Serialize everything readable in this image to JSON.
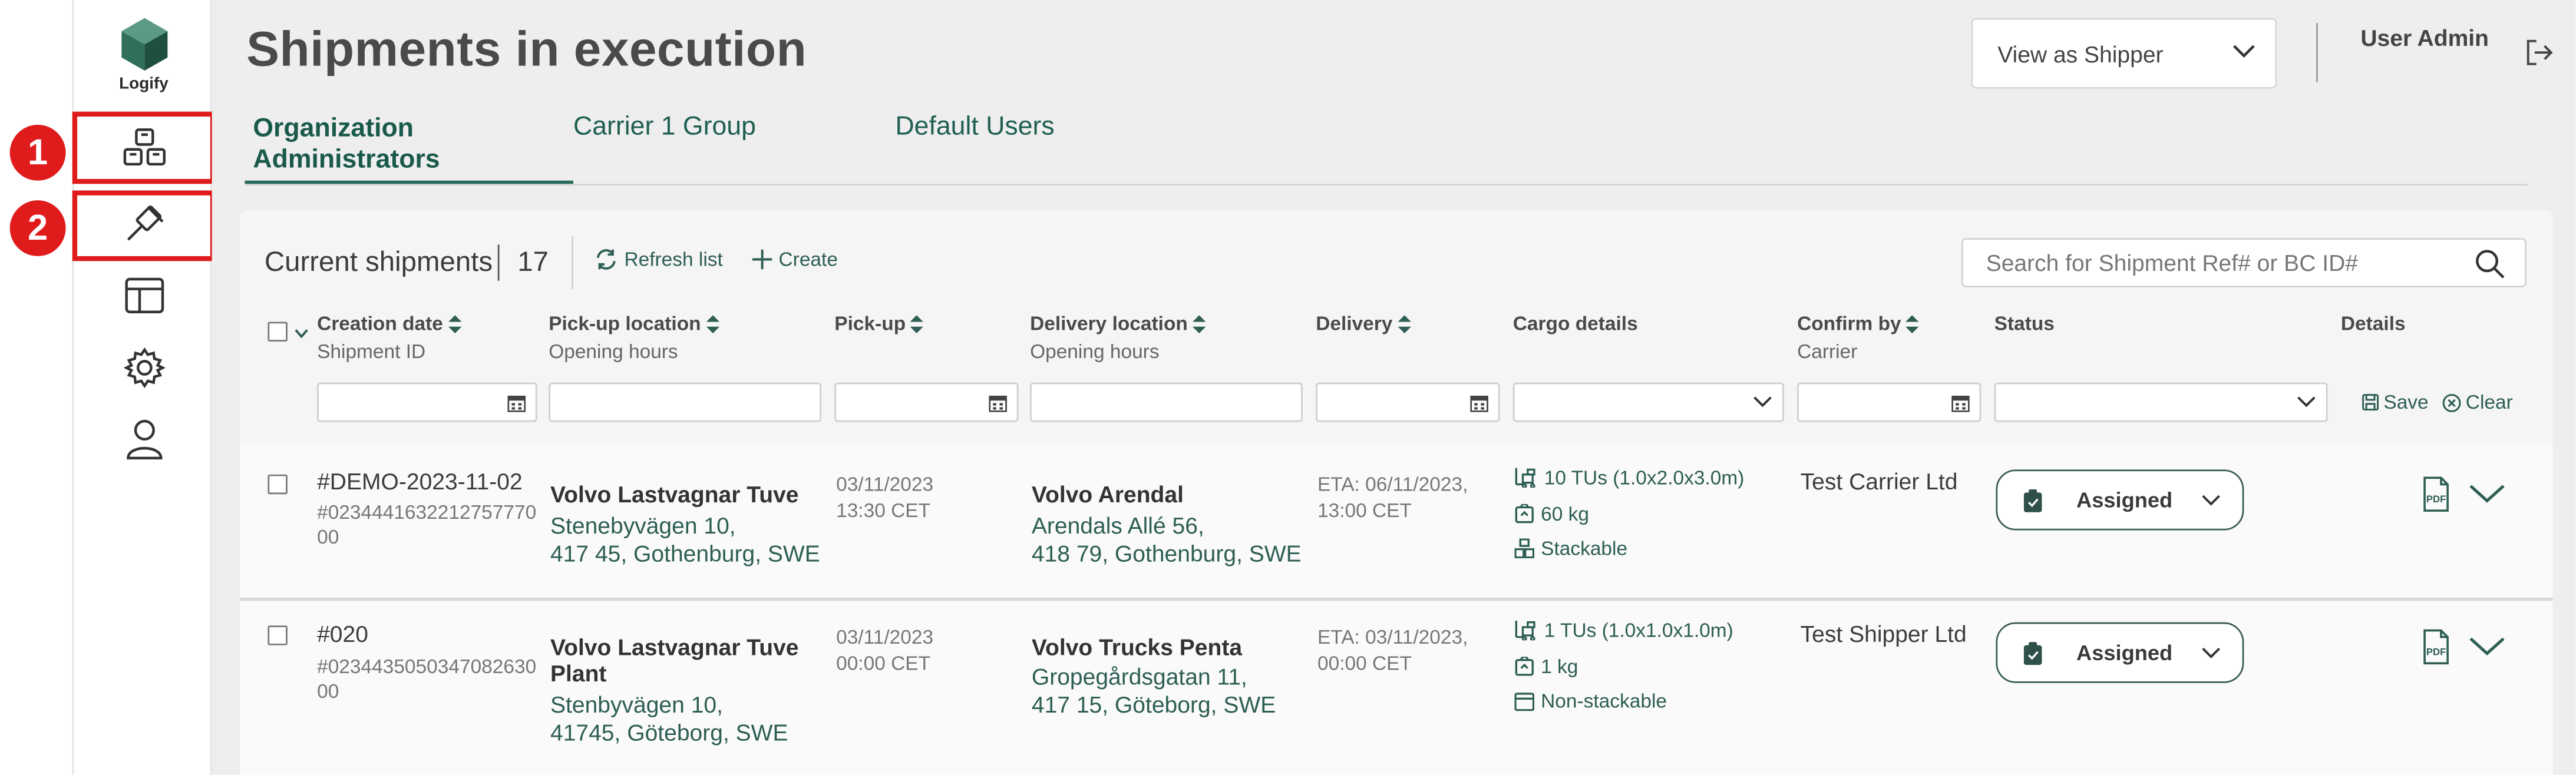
{
  "app": {
    "logo_text": "Logify"
  },
  "sidebar": {
    "items": [
      {
        "icon": "boxes-icon",
        "label": "Shipments"
      },
      {
        "icon": "gavel-icon",
        "label": "Tendering"
      },
      {
        "icon": "layout-icon",
        "label": "Dashboard"
      },
      {
        "icon": "gear-icon",
        "label": "Settings"
      },
      {
        "icon": "user-icon",
        "label": "Profile"
      }
    ],
    "highlights": [
      {
        "number": "1"
      },
      {
        "number": "2"
      }
    ],
    "highlight_color": "#e01b1b"
  },
  "header": {
    "title": "Shipments in execution",
    "view_select": {
      "value": "View as Shipper"
    },
    "user_name": "User Admin"
  },
  "tabs": [
    {
      "label_line1": "Organization",
      "label_line2": "Administrators",
      "active": true
    },
    {
      "label": "Carrier 1 Group",
      "active": false
    },
    {
      "label": "Default Users",
      "active": false
    }
  ],
  "panel": {
    "title": "Current shipments",
    "count": "17",
    "refresh_label": "Refresh list",
    "create_label": "Create",
    "search_placeholder": "Search for Shipment Ref# or BC ID#"
  },
  "columns": {
    "creation": {
      "title": "Creation date",
      "sub": "Shipment ID"
    },
    "pickup_loc": {
      "title": "Pick-up location",
      "sub": "Opening hours"
    },
    "pickup": {
      "title": "Pick-up"
    },
    "delivery_loc": {
      "title": "Delivery location",
      "sub": "Opening hours"
    },
    "delivery": {
      "title": "Delivery"
    },
    "cargo": {
      "title": "Cargo details"
    },
    "confirm": {
      "title": "Confirm by",
      "sub": "Carrier"
    },
    "status": {
      "title": "Status"
    },
    "details": {
      "title": "Details"
    }
  },
  "filters": {
    "save_label": "Save",
    "clear_label": "Clear"
  },
  "rows": [
    {
      "id": "#DEMO-2023-11-02",
      "bc_id_1": "#0234441632212757770",
      "bc_id_2": "00",
      "pickup_name": "Volvo Lastvagnar Tuve",
      "pickup_name_2": "",
      "pickup_addr1": "Stenebyvägen 10,",
      "pickup_addr2": "417 45, Gothenburg, SWE",
      "pickup_date": "03/11/2023",
      "pickup_time": "13:30 CET",
      "delivery_name": "Volvo Arendal",
      "delivery_addr1": "Arendals Allé 56,",
      "delivery_addr2": "418 79, Gothenburg, SWE",
      "eta_line1": "ETA:  06/11/2023,",
      "eta_line2": "13:00 CET",
      "cargo_tus": "10 TUs (1.0x2.0x3.0m)",
      "cargo_weight": "60 kg",
      "cargo_stack": "Stackable",
      "confirm_by": "Test Carrier Ltd",
      "status": "Assigned"
    },
    {
      "id": "#020",
      "bc_id_1": "#0234435050347082630",
      "bc_id_2": "00",
      "pickup_name": "Volvo Lastvagnar Tuve",
      "pickup_name_2": "Plant",
      "pickup_addr1": "Stenbyvägen 10,",
      "pickup_addr2": "41745, Göteborg, SWE",
      "pickup_date": "03/11/2023",
      "pickup_time": "00:00 CET",
      "delivery_name": "Volvo Trucks Penta",
      "delivery_addr1": "Gropegårdsgatan 11,",
      "delivery_addr2": "417 15, Göteborg, SWE",
      "eta_line1": "ETA:  03/11/2023,",
      "eta_line2": "00:00 CET",
      "cargo_tus": "1 TUs (1.0x1.0x1.0m)",
      "cargo_weight": "1 kg",
      "cargo_stack": "Non-stackable",
      "confirm_by": "Test Shipper Ltd",
      "status": "Assigned"
    }
  ]
}
